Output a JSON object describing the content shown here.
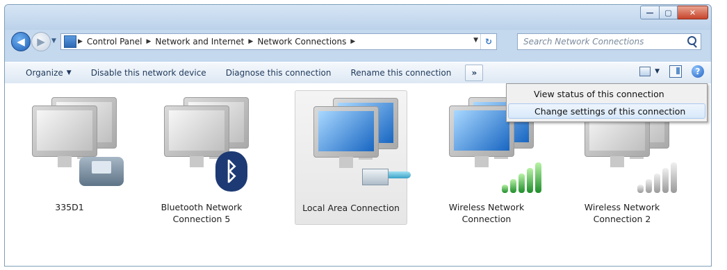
{
  "window": {
    "caption": {
      "minimize": "—",
      "maximize": "▢",
      "close": "✕"
    }
  },
  "address": {
    "crumbs": [
      "Control Panel",
      "Network and Internet",
      "Network Connections"
    ],
    "search_placeholder": "Search Network Connections"
  },
  "toolbar": {
    "organize": "Organize",
    "disable": "Disable this network device",
    "diagnose": "Diagnose this connection",
    "rename": "Rename this connection",
    "more": "»",
    "help": "?"
  },
  "connections": [
    {
      "label": "335D1",
      "icon": "dialup-phone-icon"
    },
    {
      "label": "Bluetooth Network Connection 5",
      "icon": "bluetooth-icon"
    },
    {
      "label": "Local Area Connection",
      "icon": "ethernet-cable-icon",
      "selected": true
    },
    {
      "label": "Wireless Network Connection",
      "icon": "wifi-signal-icon"
    },
    {
      "label": "Wireless Network Connection 2",
      "icon": "wifi-signal-disabled-icon"
    }
  ],
  "context_menu": {
    "items": [
      "View status of this connection",
      "Change settings of this connection"
    ],
    "highlighted_index": 1
  },
  "colors": {
    "titlebar": "#c4d8ee",
    "selection": "#e6e6e6",
    "menu_highlight": "#d8e8fa"
  }
}
